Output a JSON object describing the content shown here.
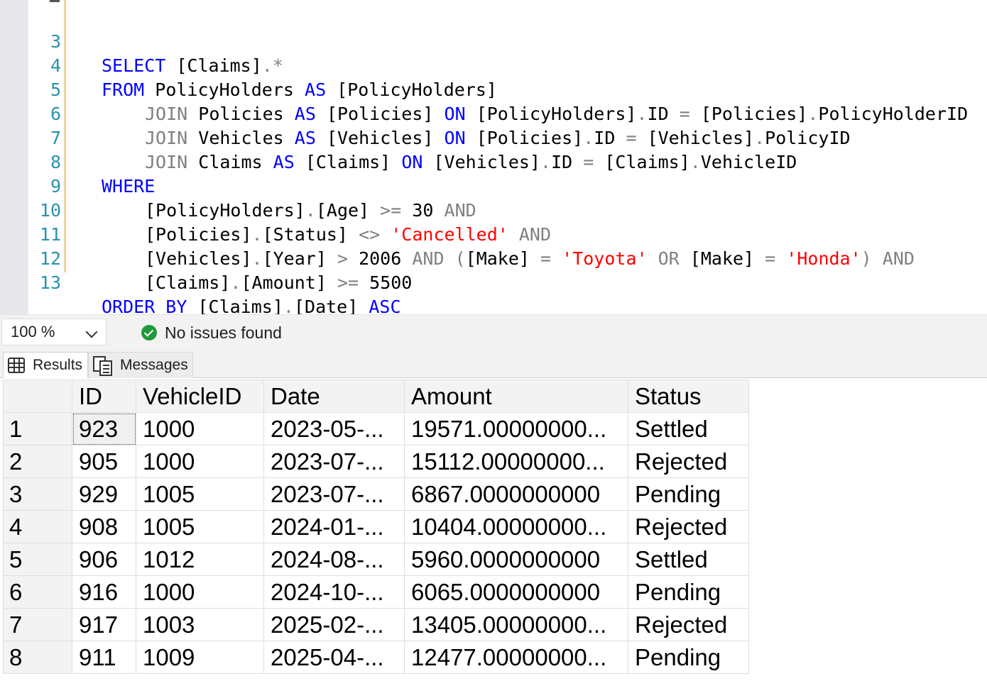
{
  "editor": {
    "lines": [
      {
        "no": "3"
      },
      {
        "no": "4"
      },
      {
        "no": "5"
      },
      {
        "no": "6"
      },
      {
        "no": "7"
      },
      {
        "no": "8"
      },
      {
        "no": "9"
      },
      {
        "no": "10"
      },
      {
        "no": "11"
      },
      {
        "no": "12"
      },
      {
        "no": "13"
      }
    ],
    "tokens": {
      "select": "SELECT",
      "from": "FROM",
      "join": "JOIN",
      "as": "AS",
      "on": "ON",
      "where": "WHERE",
      "and": "AND",
      "or": "OR",
      "order_by": "ORDER BY",
      "asc": "ASC",
      "claims_b": "[Claims]",
      "star": ".*",
      "policyholders": "PolicyHolders",
      "policyholders_b": "[PolicyHolders]",
      "policies": "Policies",
      "policies_b": "[Policies]",
      "vehicles": "Vehicles",
      "vehicles_b": "[Vehicles]",
      "claims": "Claims",
      "id": "ID",
      "policyholderid": "PolicyHolderID",
      "policyid": "PolicyID",
      "vehicleid": "VehicleID",
      "age_b": "[Age]",
      "status_b": "[Status]",
      "year_b": "[Year]",
      "make_b": "[Make]",
      "amount_b": "[Amount]",
      "date_b": "[Date]",
      "cancelled": "'Cancelled'",
      "toyota": "'Toyota'",
      "honda": "'Honda'",
      "n30": "30",
      "n2006": "2006",
      "n5500": "5500",
      "eq": "=",
      "ge": ">=",
      "gt": ">",
      "ne": "<>",
      "dot": ".",
      "lp": "(",
      "rp": ")"
    }
  },
  "status_bar": {
    "zoom": "100 %",
    "issues": "No issues found",
    "issues_icon": "check-circle-icon",
    "issues_color": "#1f9a3a"
  },
  "tabs": {
    "results": "Results",
    "messages": "Messages"
  },
  "results": {
    "columns": [
      "",
      "ID",
      "VehicleID",
      "Date",
      "Amount",
      "Status"
    ],
    "rows": [
      [
        "1",
        "923",
        "1000",
        "2023-05-...",
        "19571.00000000...",
        "Settled"
      ],
      [
        "2",
        "905",
        "1000",
        "2023-07-...",
        "15112.00000000...",
        "Rejected"
      ],
      [
        "3",
        "929",
        "1005",
        "2023-07-...",
        "6867.0000000000",
        "Pending"
      ],
      [
        "4",
        "908",
        "1005",
        "2024-01-...",
        "10404.00000000...",
        "Rejected"
      ],
      [
        "5",
        "906",
        "1012",
        "2024-08-...",
        "5960.0000000000",
        "Settled"
      ],
      [
        "6",
        "916",
        "1000",
        "2024-10-...",
        "6065.0000000000",
        "Pending"
      ],
      [
        "7",
        "917",
        "1003",
        "2025-02-...",
        "13405.00000000...",
        "Rejected"
      ],
      [
        "8",
        "911",
        "1009",
        "2025-04-...",
        "12477.00000000...",
        "Pending"
      ]
    ]
  }
}
